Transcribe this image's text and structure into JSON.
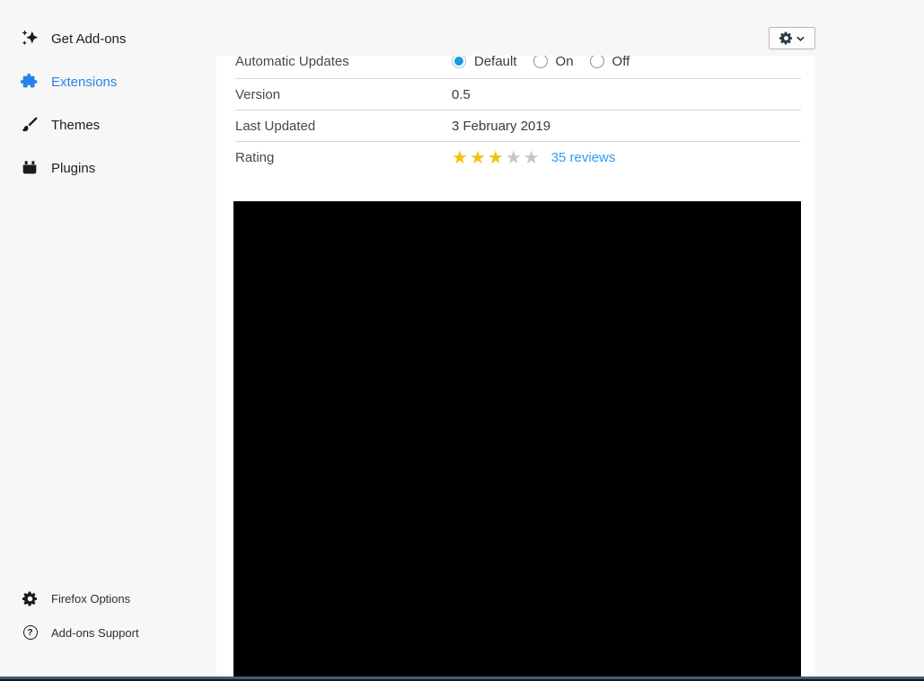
{
  "sidebar": {
    "items": [
      {
        "label": "Get Add-ons"
      },
      {
        "label": "Extensions",
        "selected": true
      },
      {
        "label": "Themes"
      },
      {
        "label": "Plugins"
      }
    ],
    "footer_items": [
      {
        "label": "Firefox Options"
      },
      {
        "label": "Add-ons Support"
      }
    ]
  },
  "details": {
    "automatic_updates": {
      "label": "Automatic Updates",
      "options": [
        "Default",
        "On",
        "Off"
      ],
      "selected": "Default"
    },
    "version": {
      "label": "Version",
      "value": "0.5"
    },
    "last_updated": {
      "label": "Last Updated",
      "value": "3 February 2019"
    },
    "rating": {
      "label": "Rating",
      "stars_filled": 3,
      "stars_total": 5,
      "reviews_link": "35 reviews"
    }
  },
  "icons": {
    "star_glyph": "★",
    "question_glyph": "?"
  },
  "colors": {
    "accent_blue": "#2684e8",
    "link_blue": "#2f9bf8",
    "star_filled": "#f2c40f",
    "star_empty": "#c5c5ca",
    "radio_selected": "#1c9be3",
    "panel_background": "#ffffff",
    "page_background": "#f7f7f8",
    "row_border": "#d7d7db"
  }
}
